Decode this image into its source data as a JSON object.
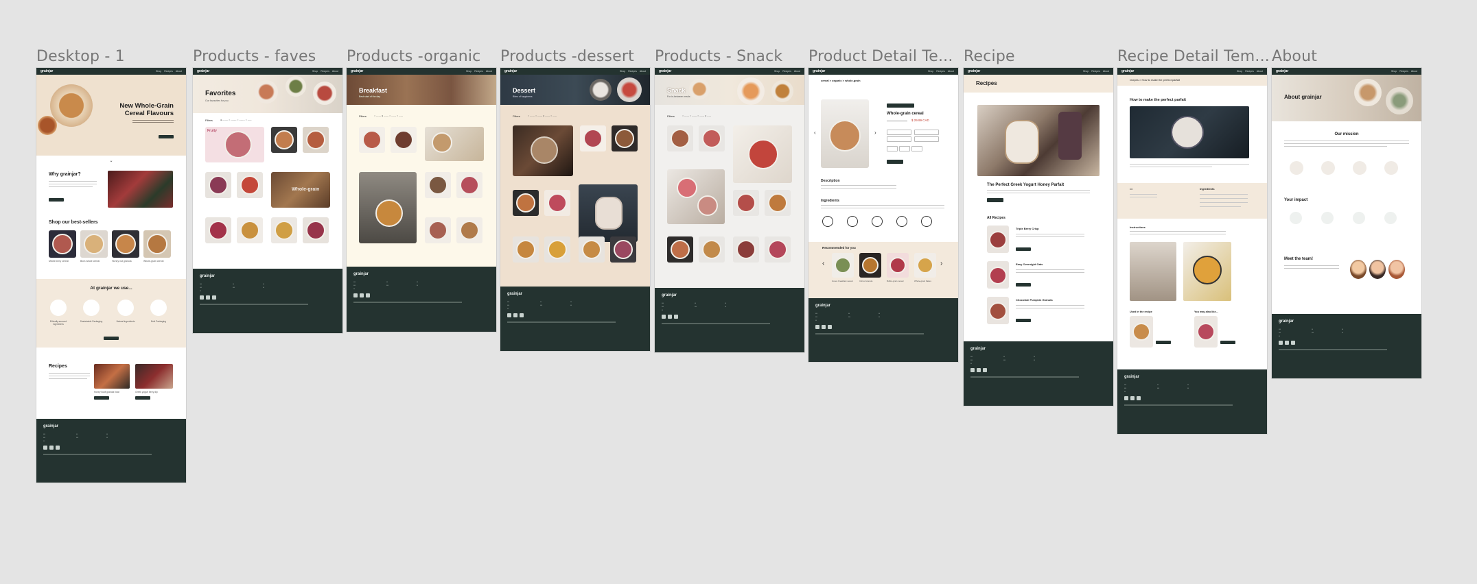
{
  "frames": [
    {
      "title": "Desktop - 1"
    },
    {
      "title": "Products - faves"
    },
    {
      "title": "Products -organic"
    },
    {
      "title": "Products -dessert"
    },
    {
      "title": "Products - Snack"
    },
    {
      "title": "Product Detail Te..."
    },
    {
      "title": "Recipe"
    },
    {
      "title": "Recipe Detail Tem..."
    },
    {
      "title": "About"
    }
  ],
  "brand": {
    "logo": "grainjar"
  },
  "desktop": {
    "hero_title": "New Whole-Grain Cereal Flavours",
    "why_title": "Why grainjar?",
    "best_title": "Shop our best-sellers",
    "best": [
      "Mixed berry cereal",
      "Bio's whole cereal",
      "Honey nut granola",
      "Whole-grain cereal"
    ],
    "use_title": "At grainjar we use...",
    "use": [
      "Ethically-sourced ingredients",
      "Sustainable Packaging",
      "Natural ingredients",
      "Bulk Packaging"
    ],
    "recipes_title": "Recipes",
    "recipes": [
      "Honey bowl granola bowl",
      "Greek yogurt berry dip"
    ]
  },
  "faves": {
    "title": "Favorites",
    "sub": "Our favourites for you",
    "filter": "Filters",
    "tag1": "Fruity",
    "tag2": "Whole-grain"
  },
  "organic": {
    "title": "Breakfast",
    "sub": "Best start of the day",
    "filter": "Filters"
  },
  "dessert": {
    "title": "Dessert",
    "sub": "Bites of happiness",
    "filter": "Filters"
  },
  "snack": {
    "title": "Snack",
    "sub": "For in-between meals",
    "filter": "Filters"
  },
  "detail": {
    "breadcrumb": "cereal  >  organic  >  whole-grain",
    "product": "Whole-grain cereal",
    "price": "$ 29.99 CAD",
    "description": "Description",
    "ingredients": "Ingredients",
    "recommended": "Recommended for you",
    "recs": [
      "Green breakfast cereal",
      "Citrus Granola",
      "Buffet-grain cereal",
      "Whole-grain flakes"
    ]
  },
  "recipe": {
    "title": "Recipes",
    "featured": "The Perfect Greek Yogurt Honey Parfait",
    "all": "All Recipes",
    "list": [
      "Triple Berry Crisp",
      "Easy Overnight Oats",
      "Chocolate Pumpkin Granola"
    ]
  },
  "recipe_detail": {
    "breadcrumb": "recipes  >  How to make the perfect parfait",
    "title": "How to make the perfect parfait",
    "ingredients": "Ingredients",
    "instructions": "Instructions",
    "used": "Used in the recipe",
    "like": "You may also like..."
  },
  "about": {
    "title": "About grainjar",
    "mission": "Our mission",
    "impact": "Your impact",
    "team": "Meet the team!"
  },
  "colors": {
    "dark": "#243330",
    "cream": "#f3e9dc",
    "canvas": "#e4e4e4"
  }
}
